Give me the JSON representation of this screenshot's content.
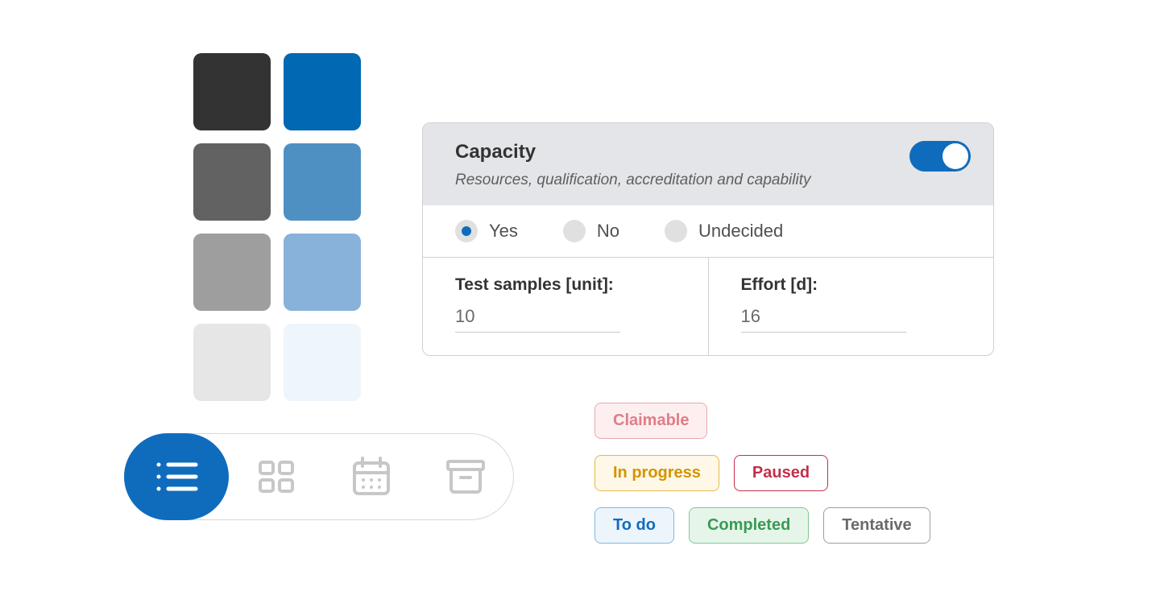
{
  "palette": {
    "swatches": [
      "#333333",
      "#0168b3",
      "#626262",
      "#4f90c2",
      "#9e9e9e",
      "#88b2da",
      "#e6e6e6",
      "#eef5fb"
    ]
  },
  "switcher": {
    "active_index": 0,
    "items": [
      "list",
      "grid",
      "calendar",
      "archive"
    ]
  },
  "card": {
    "title": "Capacity",
    "subtitle": "Resources, qualification, accreditation and capability",
    "toggle_on": true,
    "radio": {
      "options": [
        {
          "label": "Yes",
          "selected": true
        },
        {
          "label": "No",
          "selected": false
        },
        {
          "label": "Undecided",
          "selected": false
        }
      ]
    },
    "fields": {
      "samples": {
        "label": "Test samples [unit]:",
        "value": "10"
      },
      "effort": {
        "label": "Effort [d]:",
        "value": "16"
      }
    }
  },
  "chips": {
    "claimable": "Claimable",
    "inprogress": "In progress",
    "paused": "Paused",
    "todo": "To do",
    "completed": "Completed",
    "tentative": "Tentative"
  }
}
